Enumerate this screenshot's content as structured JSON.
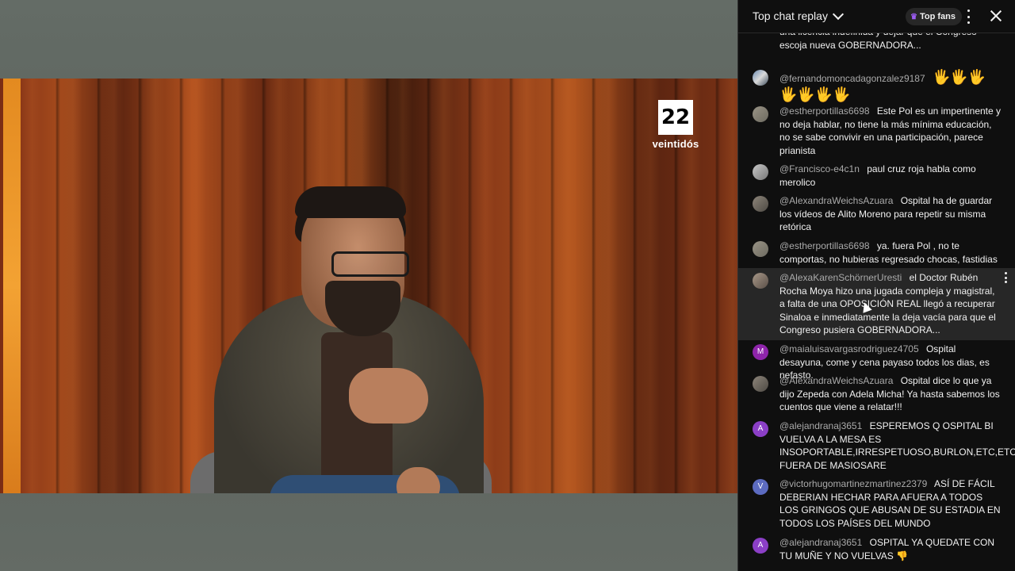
{
  "video": {
    "logo_number": "22",
    "logo_word": "veintidós"
  },
  "chat": {
    "title": "Top chat replay",
    "top_fans_label": "Top fans",
    "messages": [
      {
        "author": "",
        "text": "una licencia indefinida y dejar que el Congreso escoja nueva GOBERNADORA..."
      },
      {
        "author": "@fernandomoncadagonzalez9187",
        "text": "🖐🖐🖐🖐🖐🖐🖐"
      },
      {
        "author": "@estherportillas6698",
        "text": "Este Pol es un impertinente y no deja hablar, no tiene la más mínima educación, no se sabe convivir en una participación, parece prianista"
      },
      {
        "author": "@Francisco-e4c1n",
        "text": "paul cruz roja habla como merolico"
      },
      {
        "author": "@AlexandraWeichsAzuara",
        "text": "Ospital ha de guardar los vídeos de Alito Moreno para repetir su misma retórica"
      },
      {
        "author": "@estherportillas6698",
        "text": "ya. fuera Pol , no te comportas, no hubieras regresado chocas, fastidias"
      },
      {
        "author": "@AlexaKarenSchörnerUresti",
        "text": "el Doctor Rubén Rocha Moya hizo una jugada compleja y magistral, a falta de una OPOSICIÓN REAL llegó a recuperar Sinaloa e inmediatamente la deja vacía para que el Congreso pusiera GOBERNADORA..."
      },
      {
        "author": "@maialuisavargasrodriguez4705",
        "text": "Ospital desayuna, come y cena payaso todos los dias, es nefasto.",
        "initial": "M"
      },
      {
        "author": "@AlexandraWeichsAzuara",
        "text": "Ospital dice lo que ya dijo Zepeda con Adela Micha! Ya hasta sabemos los cuentos que viene a relatar!!!"
      },
      {
        "author": "@alejandranaj3651",
        "text": "ESPEREMOS Q OSPITAL BI VUELVA A LA MESA ES INSOPORTABLE,IRRESPETUOSO,BURLON,ETC,ETC,YA FUERA DE MASIOSARE",
        "initial": "A"
      },
      {
        "author": "@victorhugomartinezmartinez2379",
        "text": "ASÍ DE FÁCIL DEBERIAN HECHAR PARA AFUERA A TODOS LOS GRINGOS QUE ABUSAN DE SU ESTADIA EN TODOS LOS PAÍSES DEL MUNDO",
        "initial": "V"
      },
      {
        "author": "@alejandranaj3651",
        "text": "OSPITAL YA QUEDATE CON TU MUÑE Y NO VUELVAS 👎",
        "initial": "A"
      }
    ]
  }
}
